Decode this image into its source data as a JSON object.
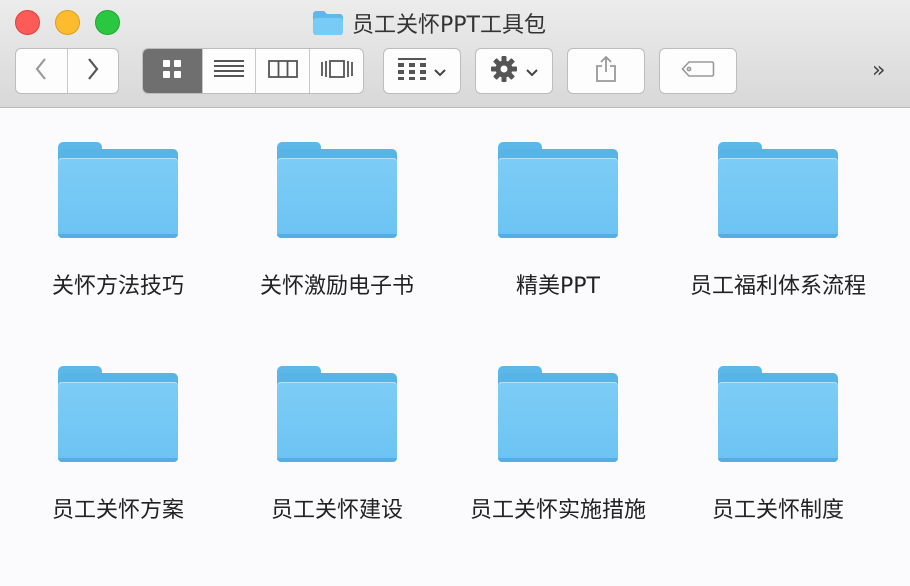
{
  "window": {
    "title": "员工关怀PPT工具包"
  },
  "toolbar": {
    "back_icon": "chevron-left-icon",
    "forward_icon": "chevron-right-icon",
    "views": [
      "icon-view",
      "list-view",
      "column-view",
      "cover-flow-view"
    ],
    "active_view": "icon-view",
    "more_label": "»"
  },
  "colors": {
    "folder_blue": "#6cc3f2",
    "close": "#fc5b57",
    "minimize": "#fcbc2e",
    "zoom": "#2ac840",
    "active_segment": "#6f6f6f"
  },
  "items": [
    {
      "label": "关怀方法技巧"
    },
    {
      "label": "关怀激励电子书"
    },
    {
      "label": "精美PPT"
    },
    {
      "label": "员工福利体系流程"
    },
    {
      "label": "员工关怀方案"
    },
    {
      "label": "员工关怀建设"
    },
    {
      "label": "员工关怀实施措施"
    },
    {
      "label": "员工关怀制度"
    }
  ]
}
